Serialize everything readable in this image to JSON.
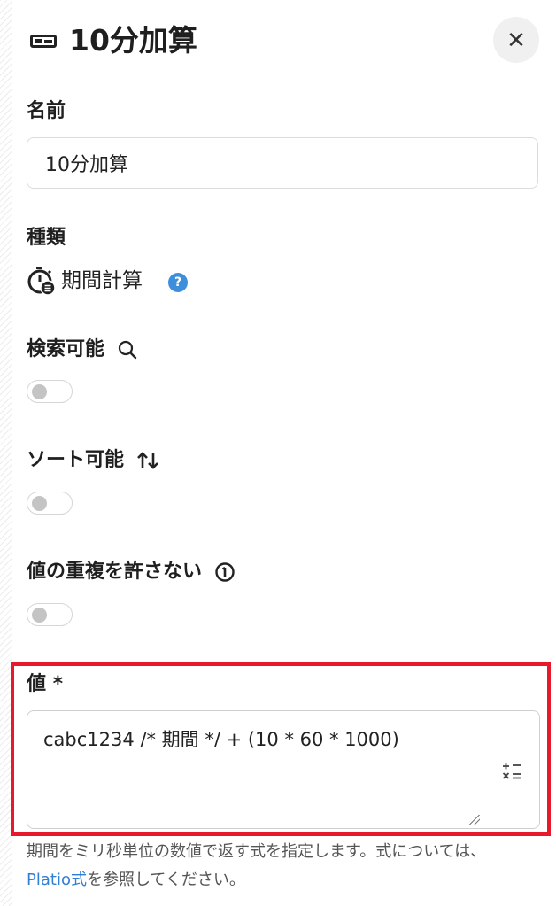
{
  "header": {
    "title": "10分加算",
    "close_label": "✕"
  },
  "name_field": {
    "label": "名前",
    "value": "10分加算"
  },
  "kind": {
    "label": "種類",
    "value": "期間計算",
    "help_glyph": "?"
  },
  "searchable": {
    "label": "検索可能",
    "enabled": false
  },
  "sortable": {
    "label": "ソート可能",
    "enabled": false
  },
  "unique": {
    "label": "値の重複を許さない",
    "enabled": false
  },
  "value_field": {
    "label": "値 *",
    "expression": "cabc1234 /* 期間 */ + (10 * 60 * 1000)"
  },
  "help_text": {
    "line1": "期間をミリ秒単位の数値で返す式を指定します。式については、",
    "link": "Platio式",
    "line2_rest": "を参照してください。"
  },
  "colors": {
    "highlight_border": "#e8192c",
    "link": "#2f7fd6",
    "help_badge": "#3d8fdc"
  },
  "icons": {
    "header": "card-icon",
    "close": "close-icon",
    "kind": "stopwatch-calc-icon",
    "help": "question-circle-icon",
    "search": "search-icon",
    "sort": "sort-arrows-icon",
    "info": "info-circle-icon",
    "formula": "formula-icon"
  }
}
